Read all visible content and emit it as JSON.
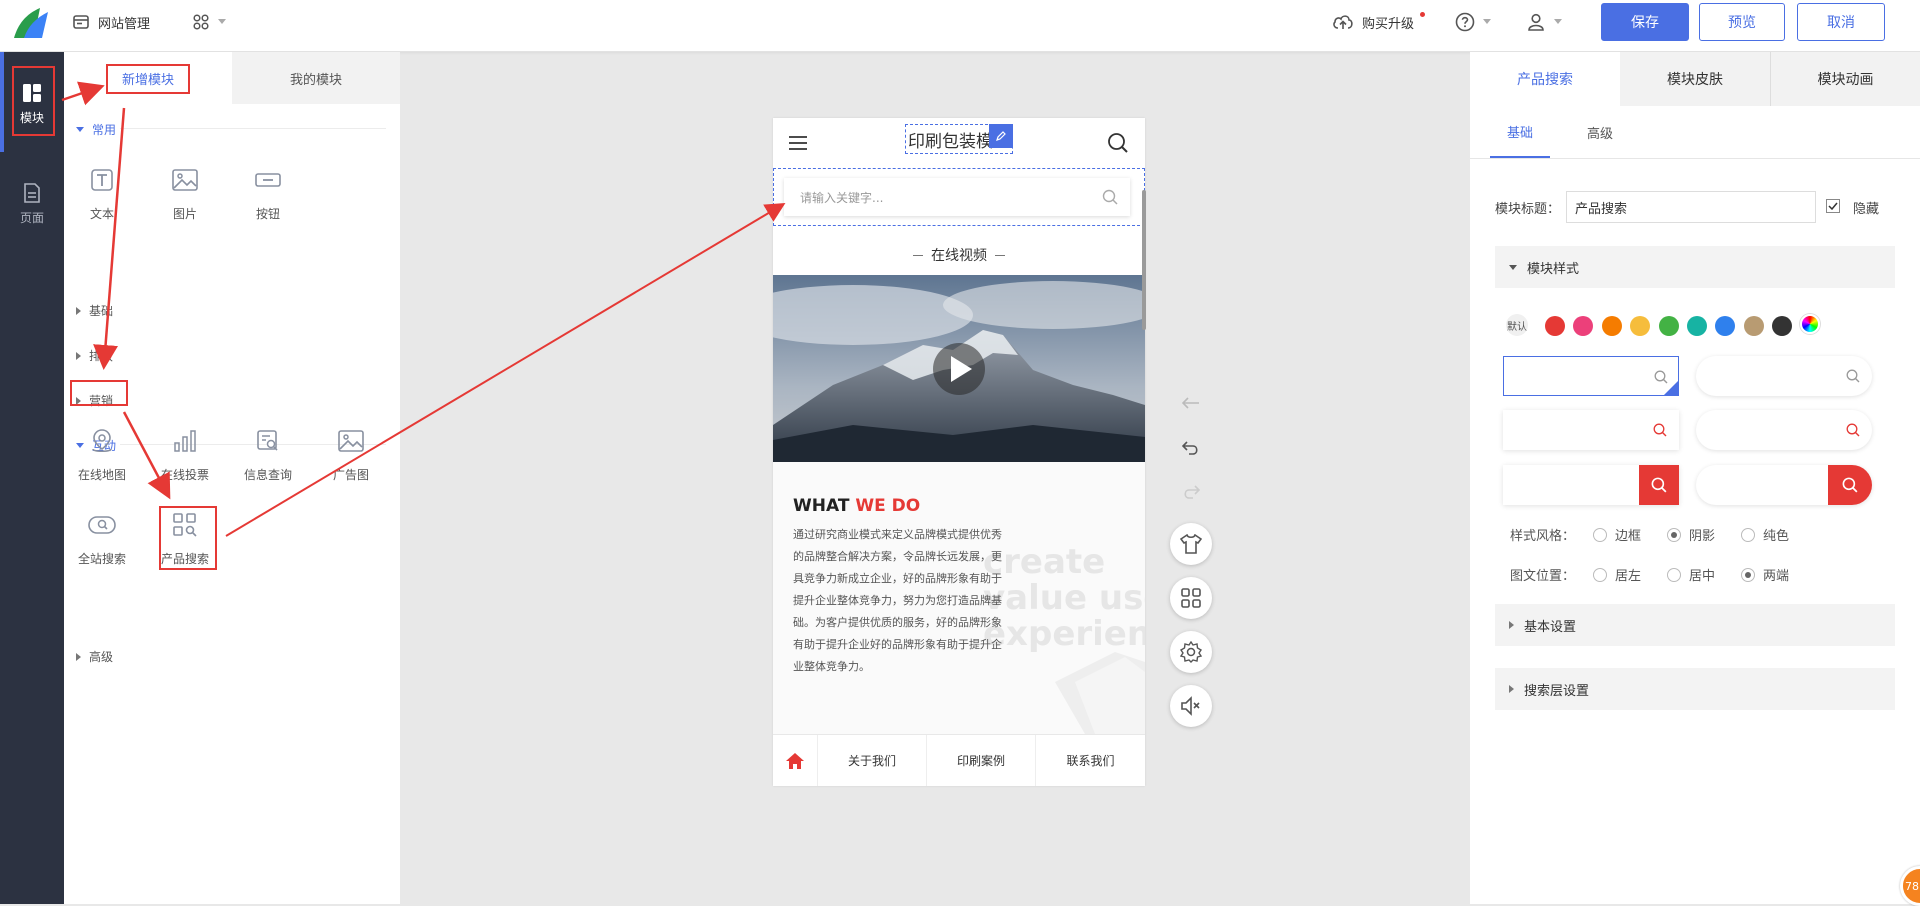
{
  "topbar": {
    "site_manage": "网站管理",
    "buy_upgrade": "购买升级",
    "save": "保存",
    "preview": "预览",
    "cancel": "取消"
  },
  "nav": {
    "modules": "模块",
    "pages": "页面"
  },
  "module_panel": {
    "tab_add": "新增模块",
    "tab_mine": "我的模块",
    "categories": {
      "common": "常用",
      "basic": "基础",
      "layout": "排版",
      "marketing": "营销",
      "interact": "互动",
      "advanced": "高级"
    },
    "common_items": [
      "文本",
      "图片",
      "按钮"
    ],
    "interact_items": [
      "在线地图",
      "在线投票",
      "信息查询",
      "广告图",
      "全站搜索",
      "产品搜索"
    ]
  },
  "phone": {
    "site_title": "印刷包装模",
    "search_placeholder": "请输入关键字...",
    "video_title": "在线视频",
    "what_prefix": "WHAT ",
    "what_accent": "WE DO",
    "bg_text": [
      "create",
      "value user",
      "experience"
    ],
    "body_text": "通过研究商业模式来定义品牌模式提供优秀的品牌整合解决方案，令品牌长远发展，更具竞争力新成立企业，好的品牌形象有助于提升企业整体竞争力，努力为您打造品牌基础。为客户提供优质的服务，好的品牌形象有助于提升企业好的品牌形象有助于提升企业整体竞争力。",
    "footer_nav": [
      "关于我们",
      "印刷案例",
      "联系我们"
    ]
  },
  "props": {
    "tabs": [
      "产品搜索",
      "模块皮肤",
      "模块动画"
    ],
    "subtabs": [
      "基础",
      "高级"
    ],
    "title_label": "模块标题：",
    "title_value": "产品搜索",
    "hide_label": "隐藏",
    "style_section": "模块样式",
    "default_swatch": "默认",
    "swatch_colors": [
      "#e53935",
      "#ec407a",
      "#f57c00",
      "#f6bd3c",
      "#43b244",
      "#17b3a3",
      "#2f80ed",
      "#b89b72",
      "#333333"
    ],
    "style_label": "样式风格：",
    "style_options": [
      "边框",
      "阴影",
      "纯色"
    ],
    "style_selected": 1,
    "align_label": "图文位置：",
    "align_options": [
      "居左",
      "居中",
      "两端"
    ],
    "align_selected": 2,
    "basic_settings": "基本设置",
    "search_layer_settings": "搜索层设置"
  },
  "badge": "78",
  "colors": {
    "accent": "#4a6fe3",
    "annotation": "#e53935",
    "sidebar": "#2c3241"
  }
}
